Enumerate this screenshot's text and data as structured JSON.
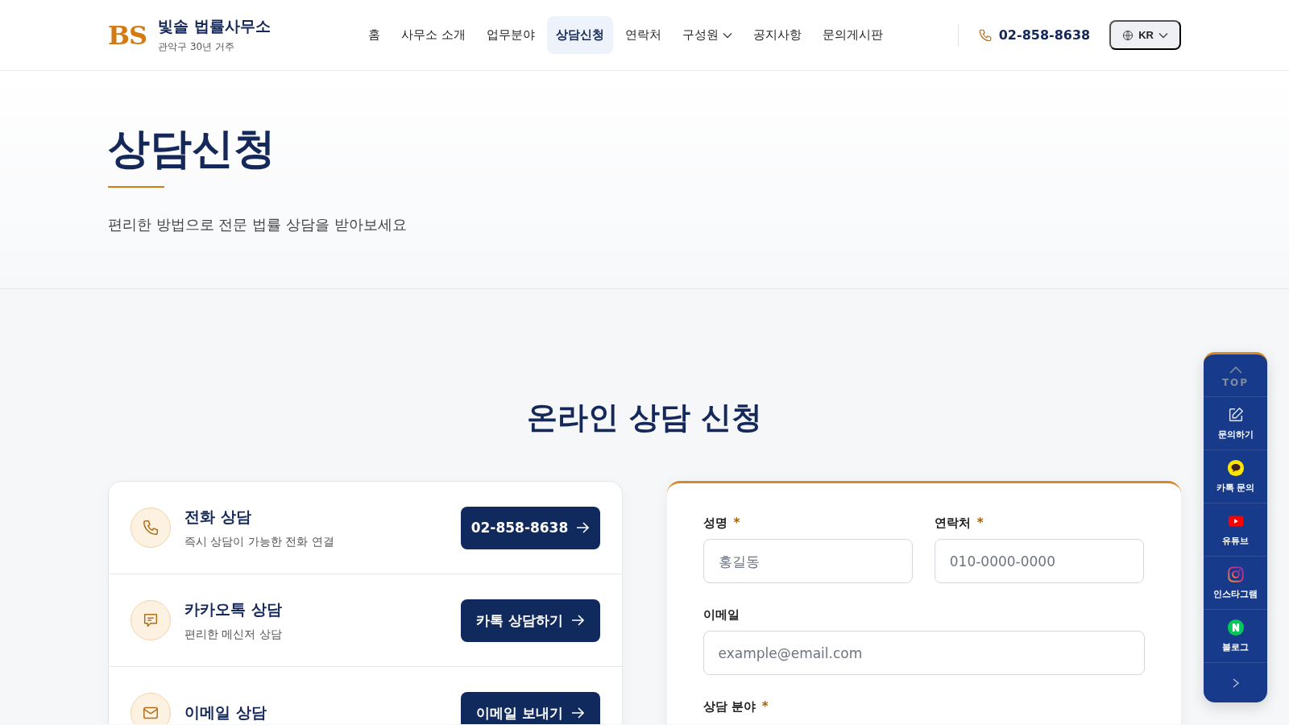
{
  "header": {
    "logo_mark": "BS",
    "logo_title": "빛솔 법률사무소",
    "logo_subtitle": "관악구 30년 거주",
    "nav": [
      {
        "label": "홈",
        "selected": false,
        "dropdown": false
      },
      {
        "label": "사무소 소개",
        "selected": false,
        "dropdown": false
      },
      {
        "label": "업무분야",
        "selected": false,
        "dropdown": false
      },
      {
        "label": "상담신청",
        "selected": true,
        "dropdown": false
      },
      {
        "label": "연락처",
        "selected": false,
        "dropdown": false
      },
      {
        "label": "구성원",
        "selected": false,
        "dropdown": true
      },
      {
        "label": "공지사항",
        "selected": false,
        "dropdown": false
      },
      {
        "label": "문의게시판",
        "selected": false,
        "dropdown": false
      }
    ],
    "phone": "02-858-8638",
    "language": "KR"
  },
  "hero": {
    "title": "상담신청",
    "subtitle": "편리한 방법으로 전문 법률 상담을 받아보세요"
  },
  "section_title": "온라인 상담 신청",
  "methods": [
    {
      "kind": "phone",
      "title": "전화 상담",
      "description": "즉시 상담이 가능한 전화 연결",
      "button": "02-858-8638"
    },
    {
      "kind": "chat",
      "title": "카카오톡 상담",
      "description": "편리한 메신저 상담",
      "button": "카톡 상담하기"
    },
    {
      "kind": "mail",
      "title": "이메일 상담",
      "button": "이메일 보내기"
    }
  ],
  "form": {
    "fields": [
      {
        "kind": "half",
        "label": "성명",
        "required_mark": "*",
        "placeholder": "홍길동"
      },
      {
        "kind": "half",
        "label": "연락처",
        "required_mark": "*",
        "placeholder": "010-0000-0000"
      },
      {
        "kind": "full",
        "label": "이메일",
        "placeholder": "example@email.com"
      },
      {
        "kind": "full",
        "label": "상담 분야",
        "required_mark": "*"
      }
    ]
  },
  "quick_menu": {
    "top": "TOP",
    "items": [
      {
        "kind": "edit",
        "label": "문의하기"
      },
      {
        "kind": "kakao",
        "label": "카톡 문의"
      },
      {
        "kind": "youtube",
        "label": "유튜브"
      },
      {
        "kind": "instagram",
        "label": "인스타그램"
      },
      {
        "kind": "naver",
        "label": "블로그"
      }
    ]
  }
}
